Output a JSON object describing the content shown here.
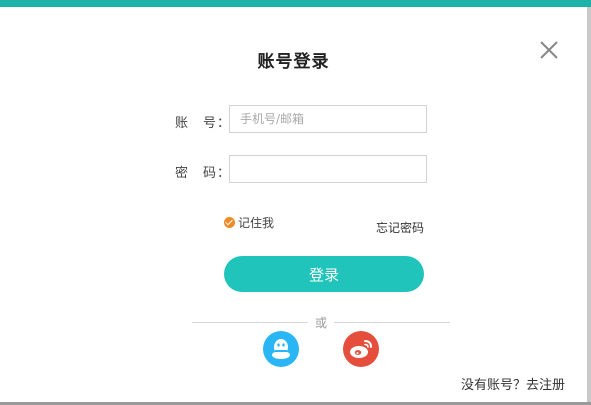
{
  "dialog": {
    "title": "账号登录",
    "account_label": "账　号：",
    "account_placeholder": "手机号/邮箱",
    "account_value": "",
    "password_label": "密　码：",
    "password_value": "",
    "remember_label": "记住我",
    "forgot_label": "忘记密码",
    "login_label": "登录",
    "divider_text": "或",
    "register_label": "没有账号？去注册"
  },
  "icons": {
    "close": "close-icon",
    "remember_check": "check-circle-icon",
    "qq": "qq-icon",
    "weibo": "weibo-icon"
  },
  "colors": {
    "accent": "#20c4bb",
    "qq": "#2ab6f5",
    "weibo": "#e54d3c",
    "check": "#f08a24"
  }
}
